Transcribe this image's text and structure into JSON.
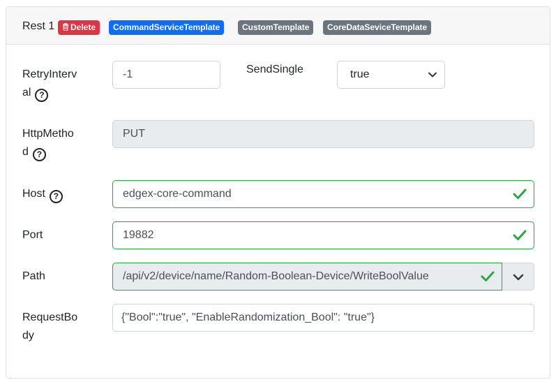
{
  "header": {
    "title": "Rest 1",
    "delete_label": "Delete",
    "badges": [
      "CommandServiceTemplate",
      "CustomTemplate",
      "CoreDataSeviceTemplate"
    ]
  },
  "form": {
    "retry_interval": {
      "label_line1": "RetryInterv",
      "label_line2": "al",
      "value": "-1"
    },
    "send_single": {
      "label": "SendSingle",
      "value": "true"
    },
    "http_method": {
      "label_line1": "HttpMetho",
      "label_line2": "d",
      "value": "PUT"
    },
    "host": {
      "label": "Host",
      "value": "edgex-core-command"
    },
    "port": {
      "label": "Port",
      "value": "19882"
    },
    "path": {
      "label": "Path",
      "value": "/api/v2/device/name/Random-Boolean-Device/WriteBoolValue"
    },
    "request_body": {
      "label_line1": "RequestBo",
      "label_line2": "dy",
      "value": "{\"Bool\":\"true\", \"EnableRandomization_Bool\": \"true\"}"
    }
  },
  "icons": {
    "help": "?"
  },
  "colors": {
    "danger": "#dc3545",
    "primary": "#0d6efd",
    "secondary": "#6c757d",
    "valid": "#28a745"
  }
}
